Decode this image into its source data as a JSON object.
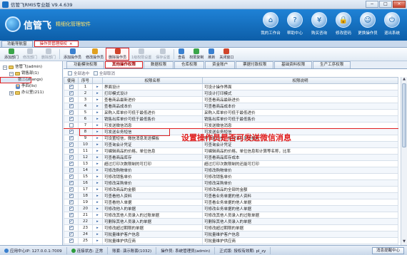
{
  "window": {
    "title": "信管飞RMIS专业版 V9.4.639",
    "buttons": [
      "−",
      "□",
      "×"
    ]
  },
  "header": {
    "brand": "信管飞",
    "slogan": "精细化管理软件",
    "tools": [
      {
        "label": "我的工作台",
        "icon": "home-icon",
        "glyph": "⌂"
      },
      {
        "label": "帮助中心",
        "icon": "help-icon",
        "glyph": "?"
      },
      {
        "label": "购买咨询",
        "icon": "cart-icon",
        "glyph": "¥"
      },
      {
        "label": "修改密码",
        "icon": "lock-icon",
        "glyph": "🔒"
      },
      {
        "label": "更换操作员",
        "icon": "user-switch-icon",
        "glyph": "☺"
      },
      {
        "label": "退出系统",
        "icon": "power-icon",
        "glyph": "⏻"
      }
    ]
  },
  "tabs": [
    {
      "label": "功能导航窗",
      "active": false
    },
    {
      "label": "操作员管理授权",
      "active": true,
      "close": "×"
    }
  ],
  "toolbar": [
    {
      "label": "添加部门",
      "icon": "add-dept-icon",
      "color": "#3aa54a",
      "disabled": false
    },
    {
      "label": "修改部门",
      "icon": "edit-dept-icon",
      "color": "#8a94a3",
      "disabled": true
    },
    {
      "label": "删除部门",
      "icon": "delete-dept-icon",
      "color": "#8a94a3",
      "disabled": true
    },
    {
      "label": "添加操作员",
      "icon": "add-user-icon",
      "color": "#3a80cf",
      "disabled": false
    },
    {
      "label": "修改操作员",
      "icon": "edit-user-icon",
      "color": "#e0a020",
      "disabled": false
    },
    {
      "label": "删除操作员",
      "icon": "delete-user-icon",
      "color": "#d0452c",
      "disabled": false,
      "highlight": true
    },
    {
      "label": "1级权限设置",
      "icon": "permission-icon",
      "color": "#8a94a3",
      "disabled": true
    },
    {
      "label": "保存设置",
      "icon": "save-icon",
      "color": "#8a94a3",
      "disabled": true
    },
    {
      "label": "查看",
      "icon": "view-icon",
      "color": "#3a80cf",
      "disabled": false
    },
    {
      "label": "权限复制",
      "icon": "copy-icon",
      "color": "#3aa54a",
      "disabled": false
    },
    {
      "label": "刷新",
      "icon": "refresh-icon",
      "color": "#3a80cf",
      "disabled": false
    },
    {
      "label": "关闭窗口",
      "icon": "close-window-icon",
      "color": "#d0452c",
      "disabled": false
    }
  ],
  "tree": [
    {
      "label": "信管飞(admin)",
      "level": 0,
      "toggle": "−",
      "type": "folder"
    },
    {
      "label": "销售部(1)",
      "level": 1,
      "toggle": "−",
      "type": "folder"
    },
    {
      "label": "张三(zhangs)",
      "level": 2,
      "toggle": "",
      "type": "person",
      "selected": true
    },
    {
      "label": "李四(lis)",
      "level": 2,
      "toggle": "",
      "type": "person"
    },
    {
      "label": "办公室(211)",
      "level": 1,
      "toggle": "+",
      "type": "folder"
    }
  ],
  "subtabs": [
    {
      "label": "功能模块权限",
      "active": false
    },
    {
      "label": "其他操作权限",
      "active": true
    },
    {
      "label": "数据权限",
      "active": false
    },
    {
      "label": "仓库权限",
      "active": false
    },
    {
      "label": "资金账户",
      "active": false
    },
    {
      "label": "票据付款权限",
      "active": false
    },
    {
      "label": "基础资料权限",
      "active": false
    },
    {
      "label": "生产工序权限",
      "active": false
    }
  ],
  "select_all": "全部选中",
  "select_none": "全部取消",
  "columns": [
    "使用",
    "序号",
    "权限名称",
    "权限说明"
  ],
  "rows": [
    {
      "on": true,
      "no": "1",
      "name": "界面设计",
      "desc": "可设计操作界面"
    },
    {
      "on": true,
      "no": "2",
      "name": "打印模式设计",
      "desc": "可设计打印模式"
    },
    {
      "on": true,
      "no": "3",
      "name": "查看商品最新进价",
      "desc": "可查看商品最新进价"
    },
    {
      "on": true,
      "no": "4",
      "name": "查看商品成本价",
      "desc": "可查看商品成本价"
    },
    {
      "on": true,
      "no": "5",
      "name": "采购入库单价可低于最低进价",
      "desc": "采购入库单价可低于最低进价"
    },
    {
      "on": true,
      "no": "6",
      "name": "销售出库单价可低于最低售价",
      "desc": "销售出库单价可低于最低售价"
    },
    {
      "on": false,
      "no": "7",
      "name": "可发送微信消息",
      "desc": "可发送微信消息",
      "highlight": true
    },
    {
      "on": true,
      "no": "8",
      "name": "可发送业务短信",
      "desc": "可发送业务短信"
    },
    {
      "on": true,
      "no": "9",
      "name": "可设置短信，微信消息发送模板",
      "desc": "可设置短信，微信消息发送模板"
    },
    {
      "on": true,
      "no": "10",
      "name": "可查询会计凭证",
      "desc": "可查询会计凭证"
    },
    {
      "on": true,
      "no": "11",
      "name": "可编辑商品的价格，单位信息",
      "desc": "可编辑商品的价格，单位信息和计算等名称，比率"
    },
    {
      "on": true,
      "no": "12",
      "name": "可查看商品库存",
      "desc": "可查看商品库存成本"
    },
    {
      "on": true,
      "no": "13",
      "name": "超过打印次数限制的可打印",
      "desc": "超过打印次数限制的还能可打印"
    },
    {
      "on": true,
      "no": "14",
      "name": "可修改购物单价",
      "desc": "可修改购物单价"
    },
    {
      "on": true,
      "no": "15",
      "name": "可修改销售单价",
      "desc": "可修改销售单价"
    },
    {
      "on": true,
      "no": "16",
      "name": "可修改采购单价",
      "desc": "可修改采购单价"
    },
    {
      "on": true,
      "no": "17",
      "name": "可修改商品的金额",
      "desc": "可修改商品的全部的金额"
    },
    {
      "on": true,
      "no": "18",
      "name": "可查看他人资料",
      "desc": "可查看业务单据的他人资料"
    },
    {
      "on": true,
      "no": "19",
      "name": "可查看他人单据",
      "desc": "可查看业务单据的他人单据"
    },
    {
      "on": true,
      "no": "20",
      "name": "可修改他人的单据",
      "desc": "可修改业务单据的他人单据"
    },
    {
      "on": true,
      "no": "21",
      "name": "可修改其他人员录入的过账单据",
      "desc": "可修改其他人员录入的过账单据"
    },
    {
      "on": true,
      "no": "22",
      "name": "可删除其他人员录入的单据",
      "desc": "可删除其他人员录入的单据"
    },
    {
      "on": true,
      "no": "23",
      "name": "可修改超过期限的单据",
      "desc": "可修改超过期限的单据"
    },
    {
      "on": true,
      "no": "24",
      "name": "可批量维护客户信息",
      "desc": "可批量维护客户信息"
    },
    {
      "on": true,
      "no": "25",
      "name": "可批量维护供应商",
      "desc": "可批量维护供应商"
    },
    {
      "on": true,
      "no": "26",
      "name": "可批量维护商品",
      "desc": "可批量维护商品资料"
    }
  ],
  "annotation": "设置操作员是否可发送微信消息",
  "status": {
    "host": "应用中心IP: 127.0.0.1:7009",
    "connection": "连接状态: 正常",
    "account": "账套: 演示账套(1032)",
    "operator": "操作员: 系统管理员(admin)",
    "license": "正式版: 授权有效期: pl_zy",
    "msg_button": "消息提醒中心"
  }
}
